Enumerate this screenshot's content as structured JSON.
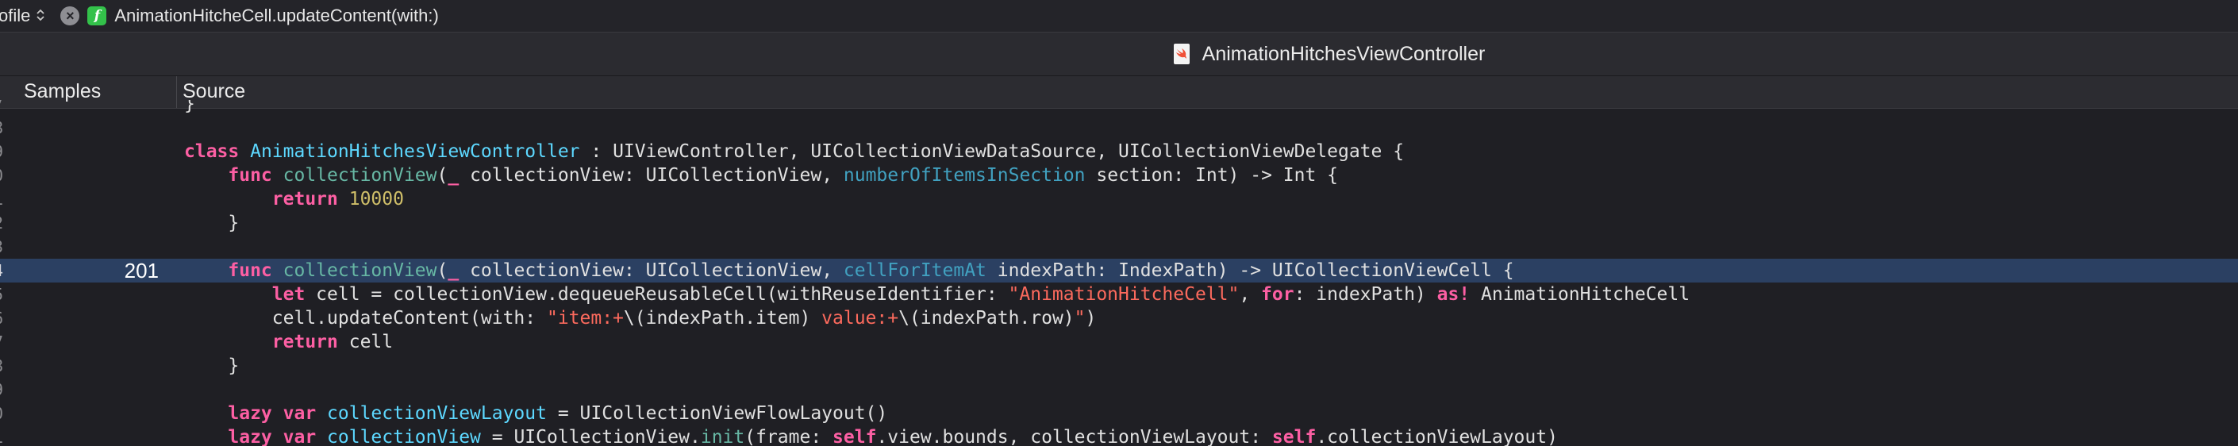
{
  "jumpbar": {
    "previous_item": "ofile",
    "updown_glyph": "⌃",
    "close_glyph": "×",
    "function_icon_glyph": "f",
    "function_name": "AnimationHitcheCell.updateContent(with:)"
  },
  "file": {
    "icon": "swift-file-icon",
    "title": "AnimationHitchesViewController"
  },
  "columns": {
    "samples": "Samples",
    "source": "Source"
  },
  "colors": {
    "keyword": "#fc5fa3",
    "type": "#5dd8ff",
    "function": "#67b7a4",
    "number": "#d0bf69",
    "string": "#fc6a5d",
    "highlight": "#2b4062"
  },
  "code_lines": [
    {
      "line": "7",
      "samples": "",
      "tokens": [
        {
          "t": "plain",
          "v": "}"
        }
      ]
    },
    {
      "line": "8",
      "samples": "",
      "tokens": []
    },
    {
      "line": "9",
      "samples": "",
      "tokens": [
        {
          "t": "kw",
          "v": "class"
        },
        {
          "t": "plain",
          "v": " "
        },
        {
          "t": "ty",
          "v": "AnimationHitchesViewController"
        },
        {
          "t": "plain",
          "v": " : UIViewController, UICollectionViewDataSource, UICollectionViewDelegate {"
        }
      ]
    },
    {
      "line": "0",
      "samples": "",
      "tokens": [
        {
          "t": "plain",
          "v": "    "
        },
        {
          "t": "kw",
          "v": "func"
        },
        {
          "t": "plain",
          "v": " "
        },
        {
          "t": "fn",
          "v": "collectionView"
        },
        {
          "t": "plain",
          "v": "("
        },
        {
          "t": "kw",
          "v": "_"
        },
        {
          "t": "plain",
          "v": " collectionView: UICollectionView, "
        },
        {
          "t": "arg",
          "v": "numberOfItemsInSection"
        },
        {
          "t": "plain",
          "v": " section: Int) -> Int {"
        }
      ]
    },
    {
      "line": "1",
      "samples": "",
      "tokens": [
        {
          "t": "plain",
          "v": "        "
        },
        {
          "t": "kw",
          "v": "return"
        },
        {
          "t": "plain",
          "v": " "
        },
        {
          "t": "num",
          "v": "10000"
        }
      ]
    },
    {
      "line": "2",
      "samples": "",
      "tokens": [
        {
          "t": "plain",
          "v": "    }"
        }
      ]
    },
    {
      "line": "3",
      "samples": "",
      "tokens": []
    },
    {
      "line": "4",
      "samples": "201",
      "highlight": true,
      "tokens": [
        {
          "t": "plain",
          "v": "    "
        },
        {
          "t": "kw",
          "v": "func"
        },
        {
          "t": "plain",
          "v": " "
        },
        {
          "t": "fn",
          "v": "collectionView"
        },
        {
          "t": "plain",
          "v": "("
        },
        {
          "t": "kw",
          "v": "_"
        },
        {
          "t": "plain",
          "v": " collectionView: UICollectionView, "
        },
        {
          "t": "arg",
          "v": "cellForItemAt"
        },
        {
          "t": "plain",
          "v": " indexPath: IndexPath) -> UICollectionViewCell {"
        }
      ]
    },
    {
      "line": "5",
      "samples": "",
      "tokens": [
        {
          "t": "plain",
          "v": "        "
        },
        {
          "t": "kw",
          "v": "let"
        },
        {
          "t": "plain",
          "v": " cell = collectionView.dequeueReusableCell(withReuseIdentifier: "
        },
        {
          "t": "str",
          "v": "\"AnimationHitcheCell\""
        },
        {
          "t": "plain",
          "v": ", "
        },
        {
          "t": "kw",
          "v": "for"
        },
        {
          "t": "plain",
          "v": ": indexPath) "
        },
        {
          "t": "kw",
          "v": "as!"
        },
        {
          "t": "plain",
          "v": " AnimationHitcheCell"
        }
      ]
    },
    {
      "line": "6",
      "samples": "",
      "tokens": [
        {
          "t": "plain",
          "v": "        cell.updateContent(with: "
        },
        {
          "t": "str",
          "v": "\"item:+"
        },
        {
          "t": "plain",
          "v": "\\(indexPath.item)"
        },
        {
          "t": "str",
          "v": " value:+"
        },
        {
          "t": "plain",
          "v": "\\(indexPath.row)"
        },
        {
          "t": "str",
          "v": "\""
        },
        {
          "t": "plain",
          "v": ")"
        }
      ]
    },
    {
      "line": "7",
      "samples": "",
      "tokens": [
        {
          "t": "plain",
          "v": "        "
        },
        {
          "t": "kw",
          "v": "return"
        },
        {
          "t": "plain",
          "v": " cell"
        }
      ]
    },
    {
      "line": "8",
      "samples": "",
      "tokens": [
        {
          "t": "plain",
          "v": "    }"
        }
      ]
    },
    {
      "line": "9",
      "samples": "",
      "tokens": []
    },
    {
      "line": "0",
      "samples": "",
      "tokens": [
        {
          "t": "plain",
          "v": "    "
        },
        {
          "t": "kw",
          "v": "lazy var"
        },
        {
          "t": "plain",
          "v": " "
        },
        {
          "t": "ty",
          "v": "collectionViewLayout"
        },
        {
          "t": "plain",
          "v": " = UICollectionViewFlowLayout()"
        }
      ]
    },
    {
      "line": "1",
      "samples": "",
      "tokens": [
        {
          "t": "plain",
          "v": "    "
        },
        {
          "t": "kw",
          "v": "lazy var"
        },
        {
          "t": "plain",
          "v": " "
        },
        {
          "t": "ty",
          "v": "collectionView"
        },
        {
          "t": "plain",
          "v": " = UICollectionView."
        },
        {
          "t": "fn",
          "v": "init"
        },
        {
          "t": "plain",
          "v": "(frame: "
        },
        {
          "t": "kw",
          "v": "self"
        },
        {
          "t": "plain",
          "v": ".view.bounds, collectionViewLayout: "
        },
        {
          "t": "kw",
          "v": "self"
        },
        {
          "t": "plain",
          "v": ".collectionViewLayout)"
        }
      ]
    }
  ]
}
